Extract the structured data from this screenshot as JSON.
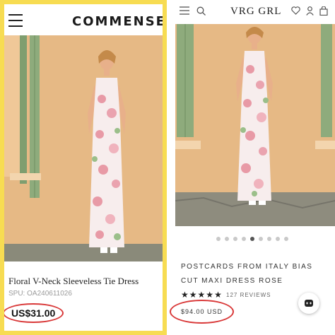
{
  "left_panel": {
    "brand": "COMMENSE",
    "product_title": "Floral V-Neck Sleeveless Tie Dress",
    "spu": "SPU: OA240611026",
    "price": "US$31.00",
    "accent_color": "#f7dc52",
    "circle_color": "#d93939"
  },
  "right_panel": {
    "brand": "VRG GRL",
    "header_icons": [
      "menu-icon",
      "search-icon",
      "heart-icon",
      "user-icon",
      "bag-icon"
    ],
    "product_title": "POSTCARDS FROM ITALY BIAS CUT MAXI DRESS ROSE",
    "rating": 5,
    "reviews": "127 REVIEWS",
    "price": "$94.00 USD",
    "carousel_total": 9,
    "carousel_active": 5
  }
}
